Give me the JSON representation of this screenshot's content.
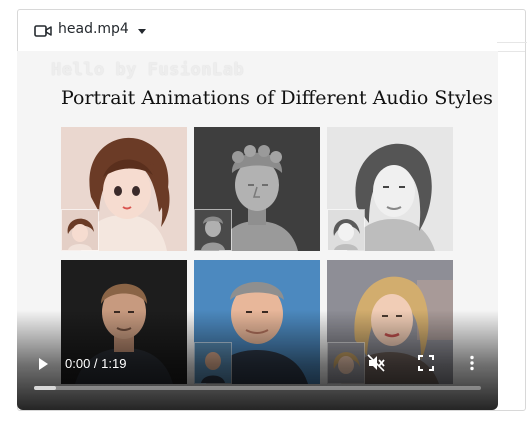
{
  "file": {
    "name": "head.mp4",
    "icon": "video-camera-icon",
    "menu_icon": "caret-down-icon"
  },
  "video": {
    "watermark": "Hello by FusionLab",
    "slide_title": "Portrait Animations of Different Audio Styles",
    "portraits": [
      {
        "name": "anime-girl-portrait",
        "style": "anime"
      },
      {
        "name": "statue-portrait",
        "style": "statue"
      },
      {
        "name": "sketch-woman-portrait",
        "style": "sketch"
      },
      {
        "name": "actor-man-portrait",
        "style": "photo"
      },
      {
        "name": "comedian-man-portrait",
        "style": "photo"
      },
      {
        "name": "blonde-singer-portrait",
        "style": "photo"
      }
    ],
    "controls": {
      "play_icon": "play-icon",
      "time": "0:00 / 1:19",
      "mute_icon": "muted-speaker-icon",
      "fullscreen_icon": "fullscreen-icon",
      "menu_icon": "vertical-dots-icon",
      "progress_fraction": 0.05
    }
  }
}
